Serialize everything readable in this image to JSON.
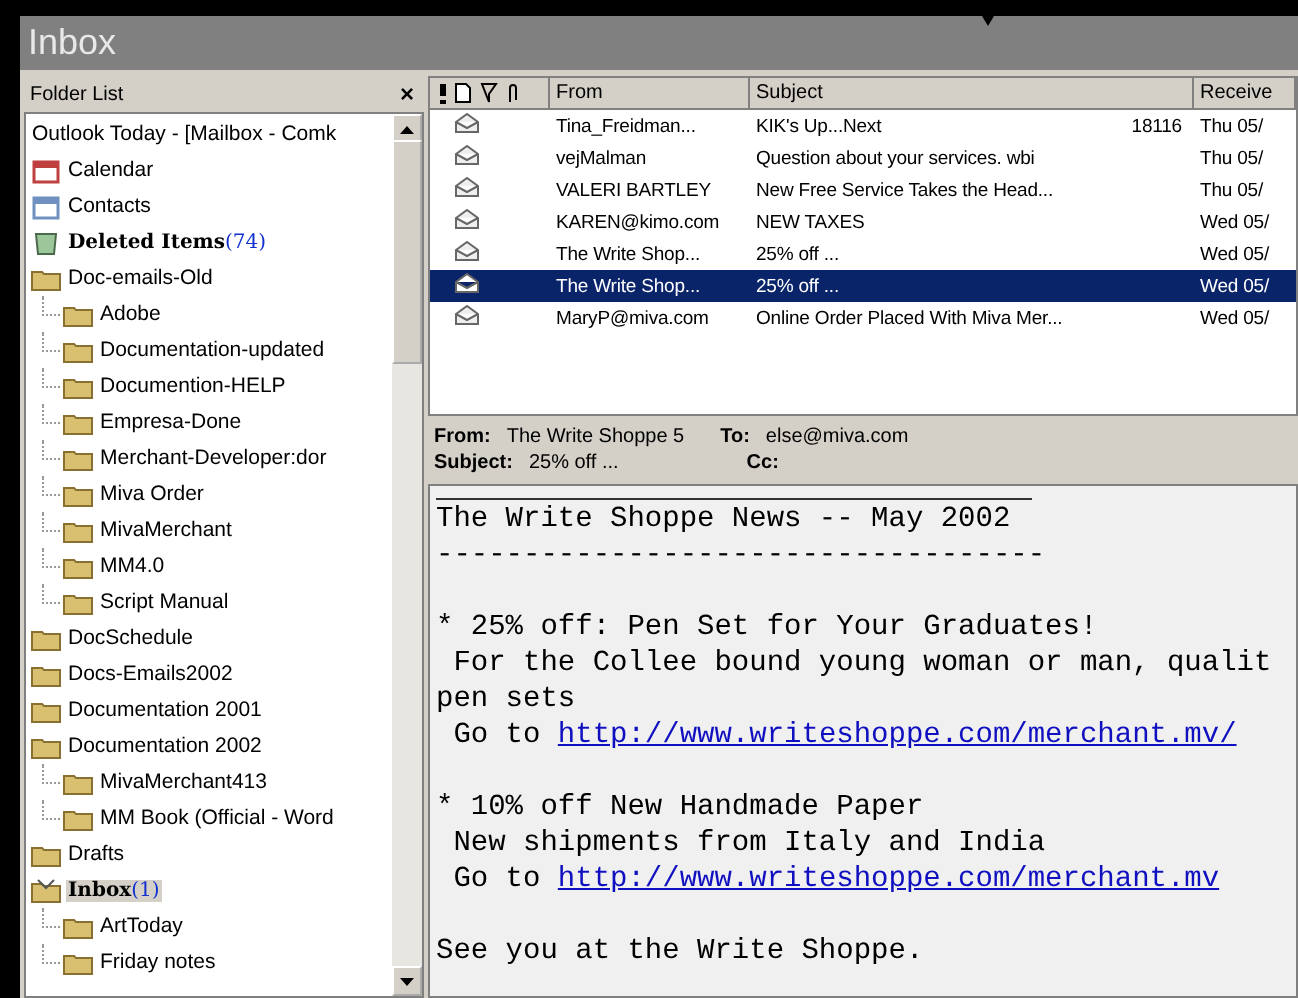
{
  "window": {
    "title": "Inbox"
  },
  "folder_list": {
    "title": "Folder List",
    "close": "×",
    "items": [
      {
        "label": "Outlook Today - [Mailbox - Comk",
        "kind": "today",
        "bold": false,
        "selected": false
      },
      {
        "label": "Calendar",
        "kind": "calendar",
        "bold": false,
        "selected": false
      },
      {
        "label": "Contacts",
        "kind": "contacts",
        "bold": false,
        "selected": false
      },
      {
        "label": "Deleted Items",
        "count": "(74)",
        "kind": "deleted",
        "bold": true,
        "selected": false
      },
      {
        "label": "Doc-emails-Old",
        "kind": "folder",
        "bold": false,
        "selected": false,
        "children": [
          {
            "label": "Adobe",
            "kind": "folder",
            "bold": false,
            "selected": false
          },
          {
            "label": "Documentation-updated",
            "kind": "folder",
            "bold": false,
            "selected": false
          },
          {
            "label": "Documention-HELP",
            "kind": "folder",
            "bold": false,
            "selected": false
          },
          {
            "label": "Empresa-Done",
            "kind": "folder",
            "bold": false,
            "selected": false
          },
          {
            "label": "Merchant-Developer:dor",
            "kind": "folder",
            "bold": false,
            "selected": false
          },
          {
            "label": "Miva Order",
            "kind": "folder",
            "bold": false,
            "selected": false
          },
          {
            "label": "MivaMerchant",
            "kind": "folder",
            "bold": false,
            "selected": false
          },
          {
            "label": "MM4.0",
            "kind": "folder",
            "bold": false,
            "selected": false
          },
          {
            "label": "Script Manual",
            "kind": "folder",
            "bold": false,
            "selected": false
          }
        ]
      },
      {
        "label": "DocSchedule",
        "kind": "folder",
        "bold": false,
        "selected": false
      },
      {
        "label": "Docs-Emails2002",
        "kind": "folder",
        "bold": false,
        "selected": false
      },
      {
        "label": "Documentation 2001",
        "kind": "folder",
        "bold": false,
        "selected": false
      },
      {
        "label": "Documentation 2002",
        "kind": "folder",
        "bold": false,
        "selected": false,
        "children": [
          {
            "label": "MivaMerchant413",
            "kind": "folder",
            "bold": false,
            "selected": false
          },
          {
            "label": "MM Book (Official - Word",
            "kind": "folder",
            "bold": false,
            "selected": false
          }
        ]
      },
      {
        "label": "Drafts",
        "kind": "drafts",
        "bold": false,
        "selected": false
      },
      {
        "label": "Inbox",
        "count": "(1)",
        "kind": "inbox",
        "bold": true,
        "selected": true,
        "children": [
          {
            "label": "ArtToday",
            "kind": "folder",
            "bold": false,
            "selected": false
          },
          {
            "label": "Friday notes",
            "kind": "folder",
            "bold": false,
            "selected": false
          }
        ]
      }
    ]
  },
  "message_list": {
    "columns": [
      "From",
      "Subject",
      "Receive"
    ],
    "rows": [
      {
        "from": "Tina_Freidman...",
        "subject": "KIK's Up...Next",
        "size": "18116",
        "received": "Thu 05/",
        "selected": false
      },
      {
        "from": "vejMalman",
        "subject": "Question about your services. wbi",
        "received": "Thu 05/",
        "selected": false
      },
      {
        "from": "VALERI BARTLEY",
        "subject": "New Free Service Takes the Head...",
        "received": "Thu 05/",
        "selected": false
      },
      {
        "from": "KAREN@kimo.com",
        "subject": "NEW TAXES",
        "received": "Wed 05/",
        "selected": false
      },
      {
        "from": "The Write Shop...",
        "subject": "25% off ...",
        "received": "Wed 05/",
        "selected": false
      },
      {
        "from": "The Write Shop...",
        "subject": "25% off ...",
        "received": "Wed 05/",
        "selected": true
      },
      {
        "from": "MaryP@miva.com",
        "subject": "Online Order Placed With Miva Mer...",
        "received": "Wed 05/",
        "selected": false
      }
    ]
  },
  "preview": {
    "from_label": "From:",
    "from": "The Write Shoppe 5",
    "to_label": "To:",
    "to": "else@miva.com",
    "subject_label": "Subject:",
    "subject": "25% off ...",
    "cc_label": "Cc:",
    "lines": [
      {
        "kind": "text",
        "text": "The Write Shoppe News -- May 2002"
      },
      {
        "kind": "text",
        "text": "-----------------------------------"
      },
      {
        "kind": "blank"
      },
      {
        "kind": "text",
        "text": "* 25% off: Pen Set for Your Graduates!"
      },
      {
        "kind": "text",
        "text": " For the Collee bound young woman or man, qualit"
      },
      {
        "kind": "text",
        "text": "pen sets"
      },
      {
        "kind": "link",
        "text": " Go to ",
        "link": "http://www.writeshoppe.com/merchant.mv/"
      },
      {
        "kind": "blank"
      },
      {
        "kind": "text",
        "text": "* 10% off New Handmade Paper"
      },
      {
        "kind": "text",
        "text": " New shipments from Italy and India"
      },
      {
        "kind": "link",
        "text": " Go to ",
        "link": "http://www.writeshoppe.com/merchant.mv"
      },
      {
        "kind": "blank"
      },
      {
        "kind": "text",
        "text": "See you at the Write Shoppe."
      }
    ]
  }
}
